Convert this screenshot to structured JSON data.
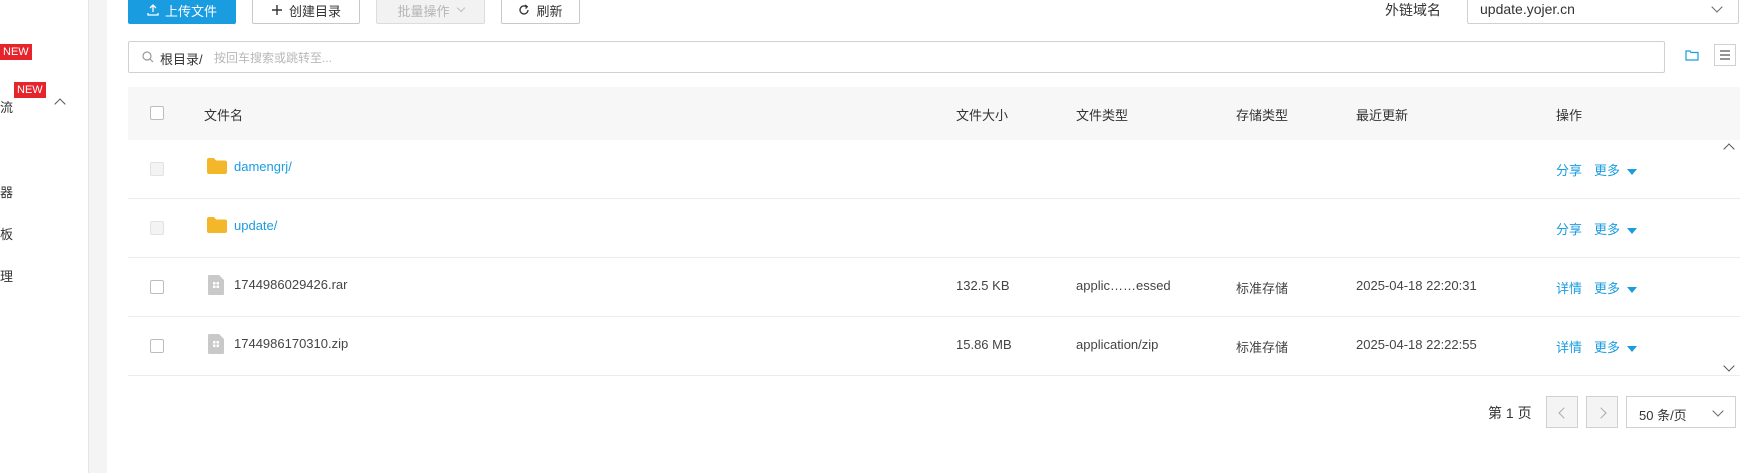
{
  "sidebar": {
    "items": [
      {
        "label": "流",
        "badge": "NEW"
      },
      {
        "label": "器"
      },
      {
        "label": "板"
      },
      {
        "label": "理"
      }
    ],
    "top_badge": "NEW"
  },
  "toolbar": {
    "upload_label": "上传文件",
    "create_dir_label": "创建目录",
    "batch_label": "批量操作",
    "refresh_label": "刷新",
    "domain_label": "外链域名",
    "domain_value": "update.yojer.cn"
  },
  "pathbar": {
    "root": "根目录/",
    "placeholder": "按回车搜索或跳转至..."
  },
  "table": {
    "headers": {
      "name": "文件名",
      "size": "文件大小",
      "type": "文件类型",
      "storage": "存储类型",
      "updated": "最近更新",
      "actions": "操作"
    },
    "rows": [
      {
        "name": "damengrj/",
        "kind": "folder",
        "size": "",
        "type": "",
        "storage": "",
        "updated": "",
        "action1": "分享",
        "action2": "更多"
      },
      {
        "name": "update/",
        "kind": "folder",
        "size": "",
        "type": "",
        "storage": "",
        "updated": "",
        "action1": "分享",
        "action2": "更多"
      },
      {
        "name": "1744986029426.rar",
        "kind": "file",
        "size": "132.5 KB",
        "type": "applic……essed",
        "storage": "标准存储",
        "updated": "2025-04-18 22:20:31",
        "action1": "详情",
        "action2": "更多"
      },
      {
        "name": "1744986170310.zip",
        "kind": "file",
        "size": "15.86 MB",
        "type": "application/zip",
        "storage": "标准存储",
        "updated": "2025-04-18 22:22:55",
        "action1": "详情",
        "action2": "更多"
      }
    ]
  },
  "pagination": {
    "page_label": "第 1 页",
    "per_page": "50 条/页"
  },
  "colors": {
    "accent": "#1a9ce0",
    "badge": "#e5242b",
    "folder": "#f5b72a"
  }
}
